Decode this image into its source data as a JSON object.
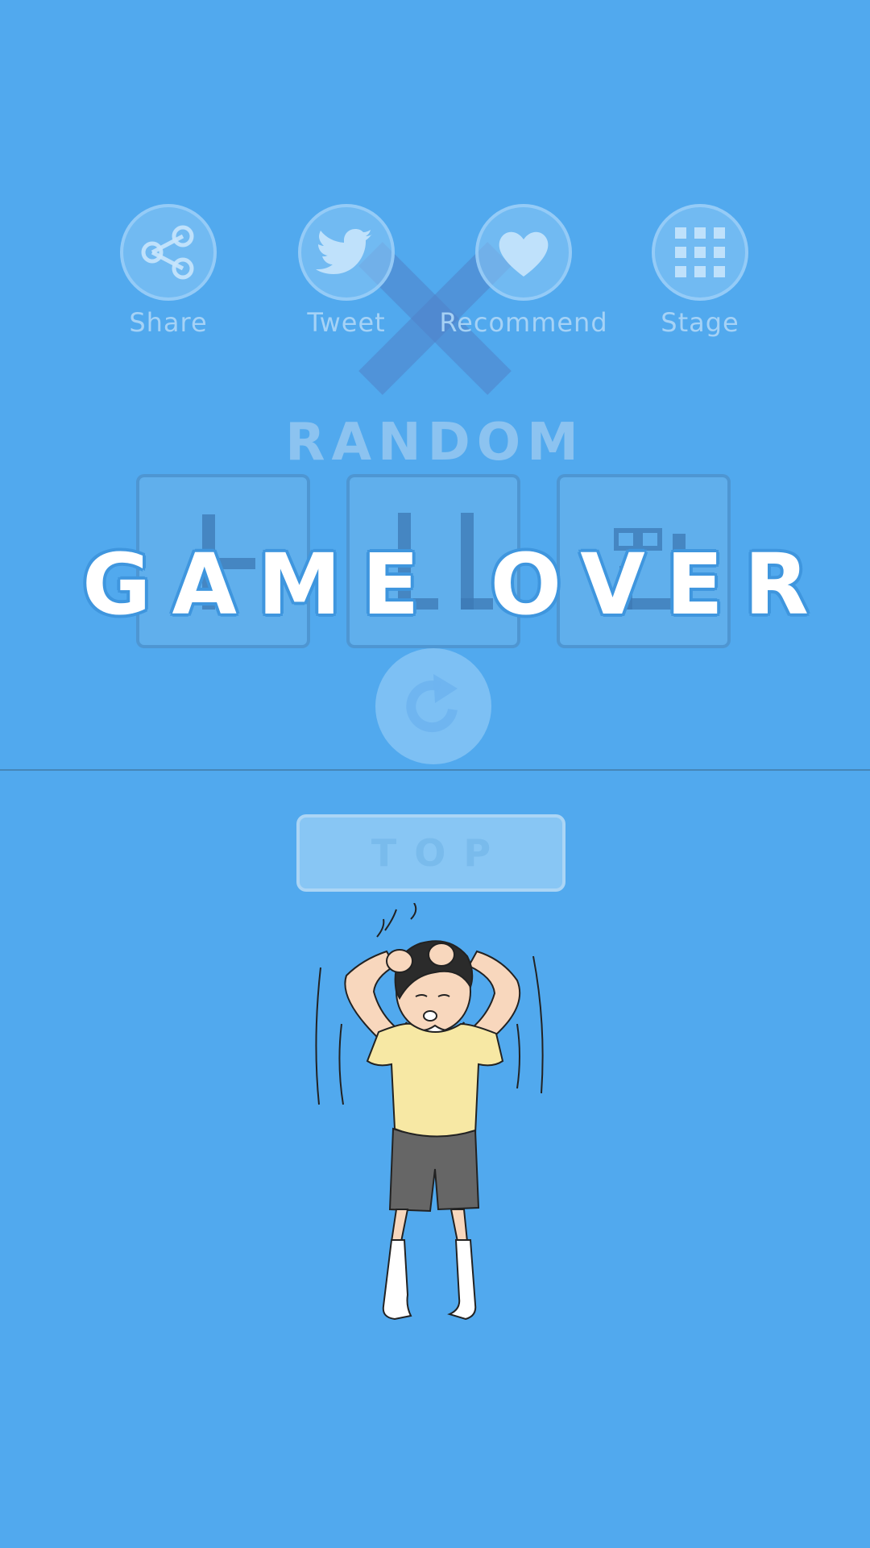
{
  "actions": [
    {
      "label": "Share",
      "icon": "share-icon"
    },
    {
      "label": "Tweet",
      "icon": "twitter-bird-icon"
    },
    {
      "label": "Recommend",
      "icon": "heart-icon"
    },
    {
      "label": "Stage",
      "icon": "grid-icon"
    }
  ],
  "random_title": "RANDOM",
  "game_over": "GAME OVER",
  "top_button": "TOP",
  "colors": {
    "background": "#51a9ee",
    "divider": "#4686b8",
    "shirt": "#f7e8a4",
    "shorts": "#666666"
  },
  "icons": {
    "cross": "big-x-icon",
    "retry": "retry-icon"
  }
}
